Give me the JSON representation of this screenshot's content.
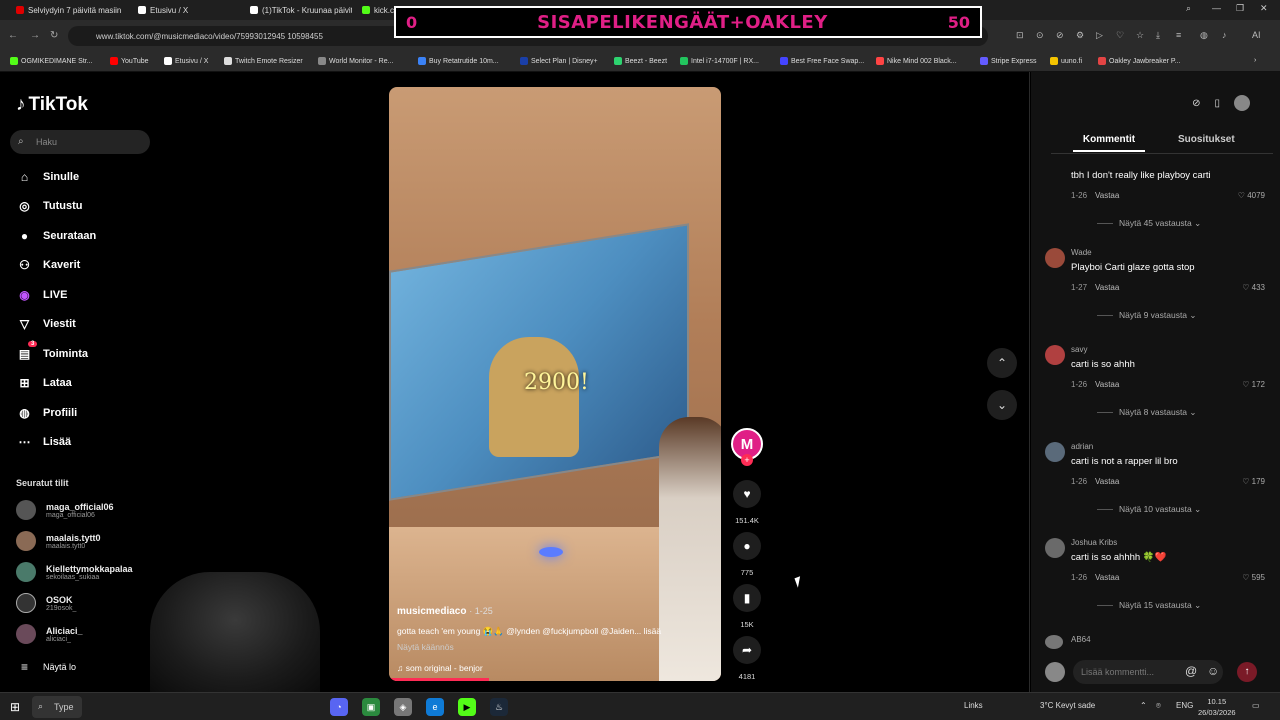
{
  "browser": {
    "tabs": [
      {
        "label": "Selviydyin 7 päivitä masiin",
        "color": "#e00000"
      },
      {
        "label": "Etusivu / X",
        "color": "#ffffff"
      },
      {
        "label": "(1)TikTok - Kruunaa päivit",
        "color": "#ffffff"
      },
      {
        "label": "kick.com",
        "color": "#53fc18"
      }
    ],
    "url": "www.tiktok.com/@musicmediaco/video/75993012945 10598455",
    "bookmarks": [
      {
        "label": "OGMIKEDIMANE Str...",
        "color": "#53fc18"
      },
      {
        "label": "YouTube",
        "color": "#ff0000"
      },
      {
        "label": "Etusivu / X",
        "color": "#ffffff"
      },
      {
        "label": "Twitch Emote Resizer",
        "color": "#dddddd"
      },
      {
        "label": "World Monitor - Re...",
        "color": "#888888"
      },
      {
        "label": "Buy Retatrutide 10m...",
        "color": "#3b82f6"
      },
      {
        "label": "Select Plan | Disney+",
        "color": "#1a3fa8"
      },
      {
        "label": "Beezt - Beezt",
        "color": "#2dd36f"
      },
      {
        "label": "Intel i7-14700F | RX...",
        "color": "#22c55e"
      },
      {
        "label": "Best Free Face Swap...",
        "color": "#4444ff"
      },
      {
        "label": "Nike Mind 002 Black...",
        "color": "#ff4444"
      },
      {
        "label": "Stripe Express",
        "color": "#635bff"
      },
      {
        "label": "uuno.fi",
        "color": "#f5c400"
      },
      {
        "label": "Oakley Jawbreaker P...",
        "color": "#e34444"
      }
    ]
  },
  "overlay": {
    "left_num": "0",
    "title": "SISAPELIKENGÄÄT+OAKLEY",
    "right_num": "50"
  },
  "sidebar": {
    "logo": "TikTok",
    "search_placeholder": "Haku",
    "nav": [
      {
        "label": "Sinulle",
        "icon": "home-icon",
        "glyph": "⌂"
      },
      {
        "label": "Tutustu",
        "icon": "compass-icon",
        "glyph": "◎"
      },
      {
        "label": "Seurataan",
        "icon": "following-icon",
        "glyph": "●"
      },
      {
        "label": "Kaverit",
        "icon": "friends-icon",
        "glyph": "⚇"
      },
      {
        "label": "LIVE",
        "icon": "live-icon",
        "glyph": "◉"
      },
      {
        "label": "Viestit",
        "icon": "messages-icon",
        "glyph": "▽"
      },
      {
        "label": "Toiminta",
        "icon": "activity-icon",
        "glyph": "▤"
      },
      {
        "label": "Lataa",
        "icon": "upload-icon",
        "glyph": "⊞"
      },
      {
        "label": "Profiili",
        "icon": "profile-icon",
        "glyph": "◍"
      },
      {
        "label": "Lisää",
        "icon": "more-icon",
        "glyph": "⋯"
      }
    ],
    "activity_badge": "3",
    "following_header": "Seuratut tilit",
    "following": [
      {
        "name": "maga_official06",
        "handle": "maga_official06",
        "color": "#555"
      },
      {
        "name": "maalais.tytt0",
        "handle": "maalais.tytt0",
        "color": "#8a6a55"
      },
      {
        "name": "Kiellettymokkapalaa",
        "handle": "sekoilaas_sukiaa",
        "color": "#4a7a6a"
      },
      {
        "name": "OSOK",
        "handle": "219osok_",
        "color": "#333"
      },
      {
        "name": "Aliciaci_",
        "handle": "aliciaci_",
        "color": "#6a4a5a"
      }
    ],
    "see_more": "Näytä lo"
  },
  "video": {
    "overlay_text": "2900!",
    "author": "musicmediaco",
    "date": "· 1-25",
    "caption": "gotta teach 'em young 😭🙏 @lynden @fuckjumpboll @Jaiden... lisää",
    "translate": "Näytä käännös",
    "sound": "♫  som original - benjor",
    "progress": 0.3
  },
  "actions": {
    "avatar_letter": "M",
    "likes": "151.4K",
    "comments": "775",
    "saves": "15K",
    "shares": "4181"
  },
  "panel": {
    "tabs": [
      "Kommentit",
      "Suositukset"
    ],
    "reply_label": "Vastaa",
    "comments": [
      {
        "user": "",
        "text": "tbh I don't really like playboy carti",
        "date": "1-26",
        "likes": "4079",
        "replies": "Näytä 45 vastausta ⌄",
        "color": "#444"
      },
      {
        "user": "Wade",
        "text": "Playboi Carti glaze gotta stop",
        "date": "1-27",
        "likes": "433",
        "replies": "Näytä 9 vastausta ⌄",
        "color": "#9a4a3a"
      },
      {
        "user": "savy",
        "text": "carti is so ahhh",
        "date": "1-26",
        "likes": "172",
        "replies": "Näytä 8 vastausta ⌄",
        "color": "#b04040"
      },
      {
        "user": "adrian",
        "text": "carti is not a rapper lil bro",
        "date": "1-26",
        "likes": "179",
        "replies": "Näytä 10 vastausta ⌄",
        "color": "#5a6a7a"
      },
      {
        "user": "Joshua Kribs",
        "text": "carti is so ahhhh 🍀❤️",
        "date": "1-26",
        "likes": "595",
        "replies": "Näytä 15 vastausta ⌄",
        "color": "#6a6a6a"
      },
      {
        "user": "AB64",
        "text": "",
        "date": "",
        "likes": "",
        "replies": "",
        "color": "#777"
      }
    ],
    "input_placeholder": "Lisää kommentti..."
  },
  "taskbar": {
    "search": "Type",
    "links": "Links",
    "weather": "3°C  Kevyt sade",
    "lang": "ENG",
    "time": "10.15",
    "date": "26/03/2026"
  }
}
